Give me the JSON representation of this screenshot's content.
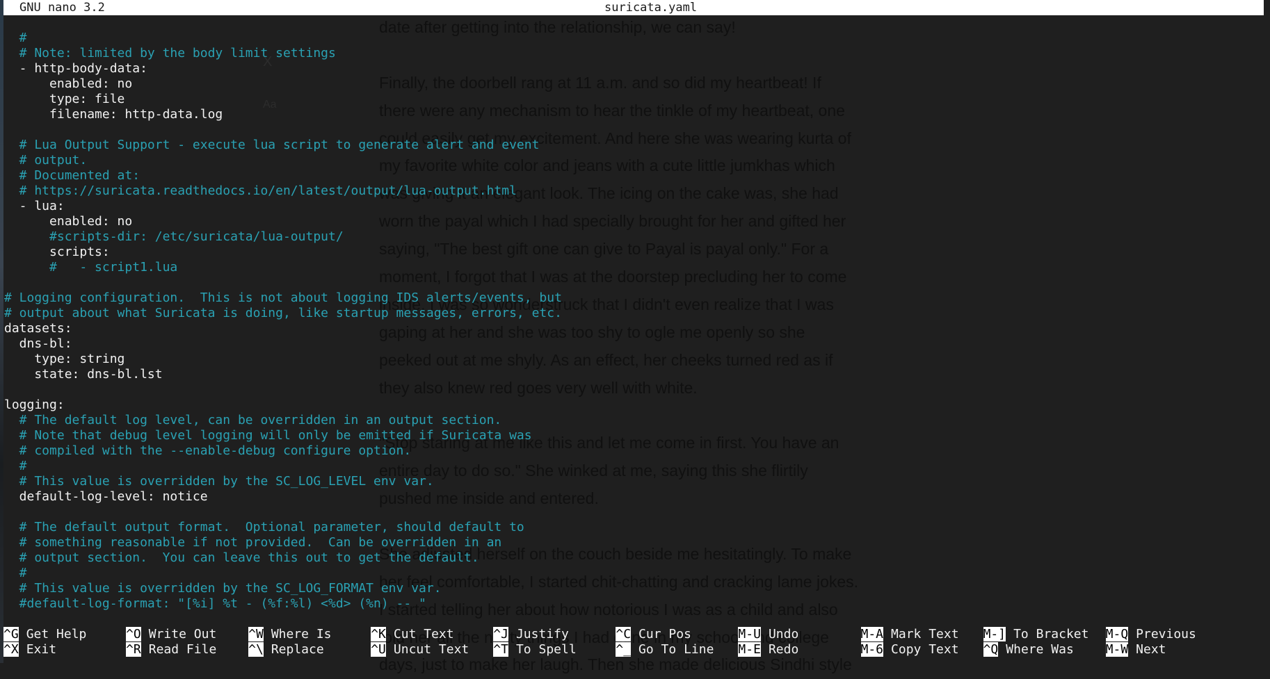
{
  "titlebar": {
    "app": "GNU nano 3.2",
    "filename": "suricata.yaml"
  },
  "editor_lines": [
    {
      "text": "",
      "kind": "plain"
    },
    {
      "text": "  #",
      "kind": "comment"
    },
    {
      "text": "  # Note: limited by the body limit settings",
      "kind": "comment"
    },
    {
      "text": "  - http-body-data:",
      "kind": "plain"
    },
    {
      "text": "      enabled: no",
      "kind": "plain"
    },
    {
      "text": "      type: file",
      "kind": "plain"
    },
    {
      "text": "      filename: http-data.log",
      "kind": "plain"
    },
    {
      "text": "",
      "kind": "plain"
    },
    {
      "text": "  # Lua Output Support - execute lua script to generate alert and event",
      "kind": "comment"
    },
    {
      "text": "  # output.",
      "kind": "comment"
    },
    {
      "text": "  # Documented at:",
      "kind": "comment"
    },
    {
      "text": "  # https://suricata.readthedocs.io/en/latest/output/lua-output.html",
      "kind": "comment"
    },
    {
      "text": "  - lua:",
      "kind": "plain"
    },
    {
      "text": "      enabled: no",
      "kind": "plain"
    },
    {
      "text": "      #scripts-dir: /etc/suricata/lua-output/",
      "kind": "comment"
    },
    {
      "text": "      scripts:",
      "kind": "plain"
    },
    {
      "text": "      #   - script1.lua",
      "kind": "comment"
    },
    {
      "text": "",
      "kind": "plain"
    },
    {
      "text": "# Logging configuration.  This is not about logging IDS alerts/events, but",
      "kind": "comment"
    },
    {
      "text": "# output about what Suricata is doing, like startup messages, errors, etc.",
      "kind": "comment"
    },
    {
      "text": "datasets:",
      "kind": "plain"
    },
    {
      "text": "  dns-bl:",
      "kind": "plain"
    },
    {
      "text": "    type: string",
      "kind": "plain"
    },
    {
      "text": "    state: dns-bl.lst",
      "kind": "plain"
    },
    {
      "text": "",
      "kind": "plain"
    },
    {
      "text": "logging:",
      "kind": "plain"
    },
    {
      "text": "  # The default log level, can be overridden in an output section.",
      "kind": "comment"
    },
    {
      "text": "  # Note that debug level logging will only be emitted if Suricata was",
      "kind": "comment"
    },
    {
      "text": "  # compiled with the --enable-debug configure option.",
      "kind": "comment"
    },
    {
      "text": "  #",
      "kind": "comment"
    },
    {
      "text": "  # This value is overridden by the SC_LOG_LEVEL env var.",
      "kind": "comment"
    },
    {
      "text": "  default-log-level: notice",
      "kind": "plain"
    },
    {
      "text": "",
      "kind": "plain"
    },
    {
      "text": "  # The default output format.  Optional parameter, should default to",
      "kind": "comment"
    },
    {
      "text": "  # something reasonable if not provided.  Can be overridden in an",
      "kind": "comment"
    },
    {
      "text": "  # output section.  You can leave this out to get the default.",
      "kind": "comment"
    },
    {
      "text": "  #",
      "kind": "comment"
    },
    {
      "text": "  # This value is overridden by the SC_LOG_FORMAT env var.",
      "kind": "comment"
    },
    {
      "text": "  #default-log-format: \"[%i] %t - (%f:%l) <%d> (%n) -- \"",
      "kind": "comment"
    }
  ],
  "help_rows": [
    [
      {
        "key": "^G",
        "label": "Get Help"
      },
      {
        "key": "^O",
        "label": "Write Out"
      },
      {
        "key": "^W",
        "label": "Where Is"
      },
      {
        "key": "^K",
        "label": "Cut Text"
      },
      {
        "key": "^J",
        "label": "Justify"
      },
      {
        "key": "^C",
        "label": "Cur Pos"
      },
      {
        "key": "M-U",
        "label": "Undo"
      },
      {
        "key": "M-A",
        "label": "Mark Text"
      },
      {
        "key": "M-]",
        "label": "To Bracket"
      },
      {
        "key": "M-Q",
        "label": "Previous"
      }
    ],
    [
      {
        "key": "^X",
        "label": "Exit"
      },
      {
        "key": "^R",
        "label": "Read File"
      },
      {
        "key": "^\\",
        "label": "Replace"
      },
      {
        "key": "^U",
        "label": "Uncut Text"
      },
      {
        "key": "^T",
        "label": "To Spell"
      },
      {
        "key": "^_",
        "label": "Go To Line"
      },
      {
        "key": "M-E",
        "label": "Redo"
      },
      {
        "key": "M-6",
        "label": "Copy Text"
      },
      {
        "key": "^Q",
        "label": "Where Was"
      },
      {
        "key": "M-W",
        "label": "Next"
      }
    ]
  ],
  "background_document": {
    "lines": [
      "date after getting into the relationship, we can say!",
      "",
      "Finally, the doorbell rang at 11 a.m. and so did my heartbeat! If",
      "there were any mechanism to hear the tinkle of my heartbeat, one",
      "could easily get my excitement. And here she was wearing kurta of",
      "my favorite white color and jeans with a cute little jumkhas which",
      "was giving it an elegant look. The icing on the cake was, she had",
      "worn the payal which I had specially brought for her and gifted her",
      "saying, \"The best gift one can give to Payal is payal only.\" For a",
      "moment, I forgot that I was at the doorstep precluding her to come",
      "inside. I was so wonderstruck that I didn't even realize that I was",
      "gaping at her and she was too shy to ogle me openly so she",
      "peeked out at me shyly. As an effect, her cheeks turned red as if",
      "they also knew red goes very well with white.",
      "",
      "\"Stop staring at me like this and let me come in first. You have an",
      "entire day to do so.\" She winked at me, saying this she flirtily",
      "pushed me inside and entered.",
      "",
      "She adjusted herself on the couch beside me hesitatingly. To make",
      "her feel comfortable, I started chit-chatting and cracking lame jokes.",
      "I started telling her about how notorious I was as a child and also",
      "told her all the nasty things I had done in my school and college",
      "days, just to make her laugh. Then she made delicious Sindhi style"
    ],
    "ghost_icons": {
      "close": "X",
      "font": "Aa"
    }
  },
  "colors": {
    "background": "#1f1f1f",
    "comment": "#2aa1b3",
    "text": "#f2f2f2",
    "titlebar": "#ffffff"
  }
}
